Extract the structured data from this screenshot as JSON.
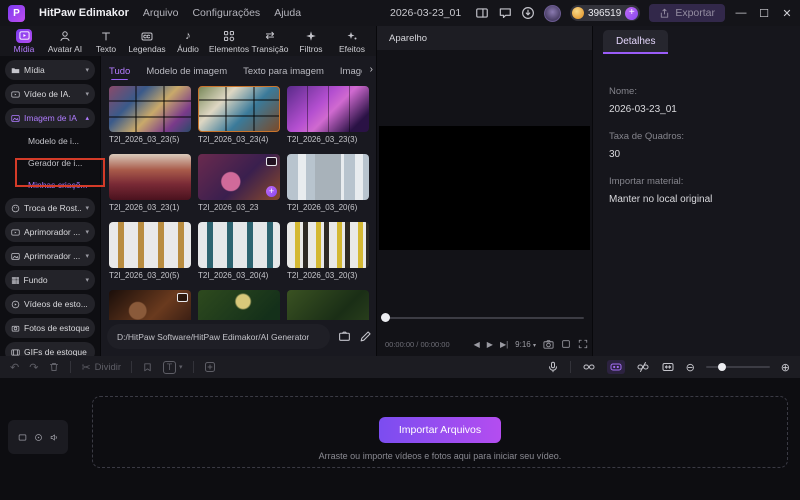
{
  "titlebar": {
    "app_title": "HitPaw Edimakor",
    "menu_items": [
      "Arquivo",
      "Configurações",
      "Ajuda"
    ],
    "document_title": "2026-03-23_01",
    "credits": "396519",
    "plus_label": "+",
    "export_label": "Exportar",
    "minimize": "—",
    "maximize": "☐",
    "close": "✕"
  },
  "ribbon": {
    "tabs": [
      {
        "label": "Mídia",
        "active": true
      },
      {
        "label": "Avatar AI"
      },
      {
        "label": "Texto"
      },
      {
        "label": "Legendas"
      },
      {
        "label": "Áudio"
      },
      {
        "label": "Elementos"
      },
      {
        "label": "Transição"
      },
      {
        "label": "Filtros"
      },
      {
        "label": "Efeitos"
      }
    ]
  },
  "sidebar": {
    "items": [
      {
        "label": "Mídia"
      },
      {
        "label": "Vídeo de IA."
      },
      {
        "label": "Imagem de IA",
        "active": true,
        "expanded": true
      },
      {
        "label": "Modelo de i...",
        "sub": true
      },
      {
        "label": "Gerador de i...",
        "sub": true
      },
      {
        "label": "Minhas criaçõ...",
        "sub": true,
        "active": true
      },
      {
        "label": "Troca de Rost..."
      },
      {
        "label": "Aprimorador ..."
      },
      {
        "label": "Aprimorador ..."
      },
      {
        "label": "Fundo"
      },
      {
        "label": "Vídeos de esto..."
      },
      {
        "label": "Fotos de estoque"
      },
      {
        "label": "GIFs de estoque"
      }
    ],
    "caret_down": "▾",
    "caret_up": "▴"
  },
  "media_panel": {
    "tabs": [
      "Tudo",
      "Modelo de imagem",
      "Texto para imagem",
      "Imagem de referência"
    ],
    "more_arrow": "›",
    "items": [
      {
        "label": "T2I_2026_03_23(5)"
      },
      {
        "label": "T2I_2026_03_23(4)"
      },
      {
        "label": "T2I_2026_03_23(3)"
      },
      {
        "label": "T2I_2026_03_23(1)"
      },
      {
        "label": "T2I_2026_03_23",
        "plus_badge": "+"
      },
      {
        "label": "T2I_2026_03_20(6)"
      },
      {
        "label": "T2I_2026_03_20(5)"
      },
      {
        "label": "T2I_2026_03_20(4)"
      },
      {
        "label": "T2I_2026_03_20(3)"
      },
      {
        "label": ""
      },
      {
        "label": ""
      },
      {
        "label": ""
      }
    ],
    "path": "D:/HitPaw Software/HitPaw Edimakor/AI Generator"
  },
  "preview": {
    "title": "Aparelho",
    "time": "00:00:00 / 00:00:00",
    "prev": "◀",
    "play": "▶",
    "next": "▶|",
    "ratio": "9:16",
    "ratio_caret": "▾"
  },
  "details": {
    "tab_label": "Detalhes",
    "fields": [
      {
        "label": "Nome:",
        "value": "2026-03-23_01"
      },
      {
        "label": "Taxa de Quadros:",
        "value": "30"
      },
      {
        "label": "Importar material:",
        "value": "Manter no local original"
      }
    ]
  },
  "toolbar": {
    "undo": "↶",
    "redo": "↷",
    "split_label": "Dividir",
    "scissors": "✂",
    "text_tool": "T",
    "caret": "▾",
    "zoom_out": "⊖",
    "zoom_in": "⊕"
  },
  "timeline": {
    "import_button_label": "Importar Arquivos",
    "hint": "Arraste ou importe vídeos e fotos aqui para iniciar seu vídeo."
  },
  "colors": {
    "accent": "#9b63f8",
    "annotation_red": "#d43b28",
    "coin_gold": "#e8a33d",
    "import_gradient_start": "#7b4df0",
    "import_gradient_end": "#b44df0"
  }
}
